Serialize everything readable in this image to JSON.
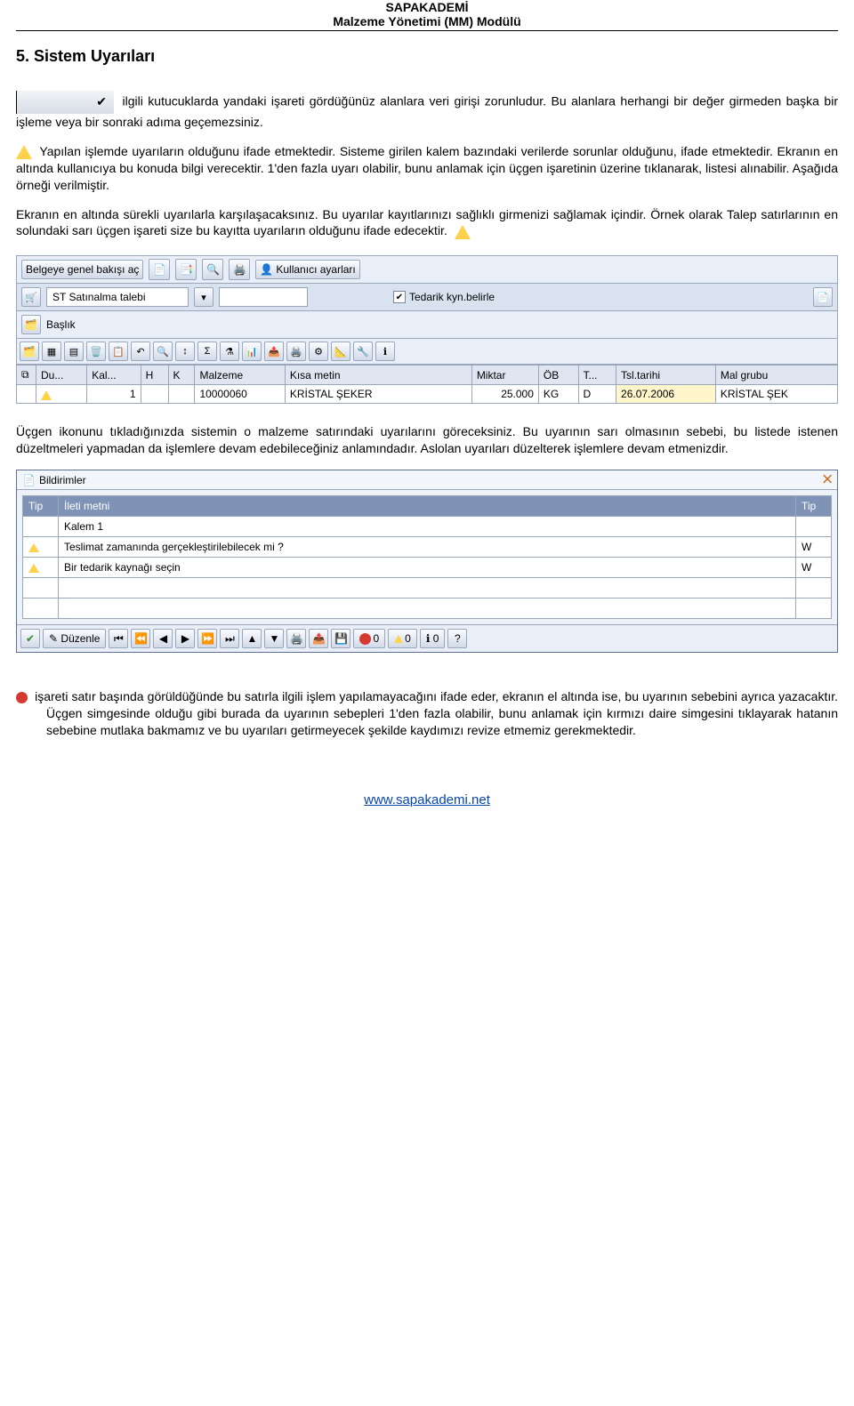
{
  "header": {
    "line1": "SAPAKADEMİ",
    "line2": "Malzeme Yönetimi (MM) Modülü"
  },
  "section_title": "5. Sistem Uyarıları",
  "para1_lead": " ilgili kutucuklarda yandaki işareti gördüğünüz alanlara veri girişi zorunludur. Bu alanlara herhangi bir değer girmeden başka bir işleme veya bir sonraki adıma geçemezsiniz.",
  "para2": " Yapılan işlemde uyarıların olduğunu ifade etmektedir. Sisteme girilen kalem bazındaki verilerde sorunlar olduğunu, ifade etmektedir. Ekranın en altında kullanıcıya bu konuda bilgi verecektir. 1'den fazla uyarı olabilir, bunu anlamak için üçgen işaretinin üzerine tıklanarak, listesi alınabilir. Aşağıda örneği verilmiştir.",
  "para3": "Ekranın en altında sürekli uyarılarla karşılaşacaksınız. Bu uyarılar kayıtlarınızı sağlıklı girmenizi sağlamak içindir. Örnek olarak Talep satırlarının en solundaki sarı üçgen işareti size bu kayıtta uyarıların olduğunu ifade edecektir.",
  "sap_toolbar": {
    "open_overview": "Belgeye genel bakışı aç",
    "user_settings": "Kullanıcı ayarları"
  },
  "sap_head": {
    "doc_type": "ST Satınalma talebi",
    "tedarik": "Tedarik kyn.belirle",
    "baslik": "Başlık"
  },
  "grid": {
    "cols": [
      "Du...",
      "Kal...",
      "H",
      "K",
      "Malzeme",
      "Kısa metin",
      "Miktar",
      "ÖB",
      "T...",
      "Tsl.tarihi",
      "Mal grubu"
    ],
    "row": {
      "du": "",
      "kal": "1",
      "h": "",
      "k": "",
      "malzeme": "10000060",
      "kisa": "KRİSTAL ŞEKER",
      "miktar": "25.000",
      "ob": "KG",
      "t": "D",
      "tarih": "26.07.2006",
      "grup": "KRİSTAL ŞEK"
    }
  },
  "para4": "Üçgen ikonunu tıkladığınızda sistemin o malzeme satırındaki uyarılarını göreceksiniz. Bu uyarının sarı olmasının sebebi, bu listede istenen düzeltmeleri yapmadan da işlemlere devam edebileceğiniz anlamındadır. Aslolan uyarıları düzelterek işlemlere devam etmenizdir.",
  "dialog": {
    "title": "Bildirimler",
    "col_tip": "Tip",
    "col_msg": "İleti metni",
    "rows": [
      {
        "tip": "",
        "msg": "Kalem 1",
        "tip2": ""
      },
      {
        "tip": "warn",
        "msg": "Teslimat zamanında gerçekleştirilebilecek mi ?",
        "tip2": "W"
      },
      {
        "tip": "warn",
        "msg": "Bir tedarik kaynağı seçin",
        "tip2": "W"
      }
    ],
    "duzenle": "Düzenle"
  },
  "para5": " işareti satır başında görüldüğünde bu satırla ilgili işlem yapılamayacağını ifade eder, ekranın el altında ise, bu uyarının sebebini ayrıca yazacaktır. Üçgen simgesinde olduğu gibi burada da uyarının sebepleri 1'den fazla olabilir, bunu anlamak için kırmızı daire simgesini tıklayarak hatanın sebebine mutlaka bakmamız ve bu uyarıları getirmeyecek şekilde kaydımızı revize etmemiz gerekmektedir.",
  "footer": "www.sapakademi.net"
}
